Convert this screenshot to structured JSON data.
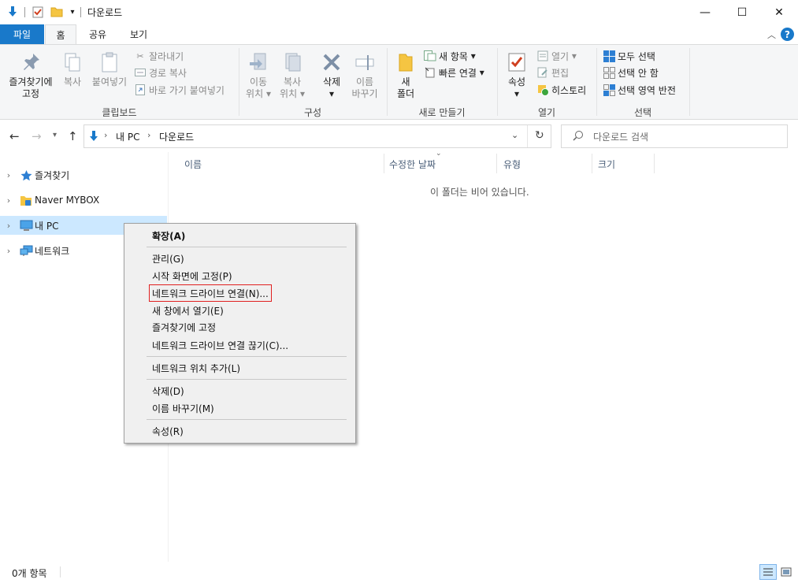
{
  "window": {
    "title": "다운로드",
    "minimize_glyph": "—",
    "maximize_glyph": "☐",
    "close_glyph": "✕"
  },
  "ribbon_tabs": [
    {
      "label": "파일"
    },
    {
      "label": "홈"
    },
    {
      "label": "공유"
    },
    {
      "label": "보기"
    }
  ],
  "ribbon": {
    "clipboard": {
      "label": "클립보드",
      "pin_line1": "즐겨찾기에",
      "pin_line2": "고정",
      "copy": "복사",
      "paste": "붙여넣기",
      "cut": "잘라내기",
      "copy_path": "경로 복사",
      "paste_shortcut": "바로 가기 붙여넣기"
    },
    "organize": {
      "label": "구성",
      "move_line1": "이동",
      "move_line2": "위치",
      "copy_line1": "복사",
      "copy_line2": "위치",
      "delete": "삭제",
      "rename_line1": "이름",
      "rename_line2": "바꾸기"
    },
    "new": {
      "label": "새로 만들기",
      "folder_line1": "새",
      "folder_line2": "폴더",
      "new_item": "새 항목",
      "easy_access": "빠른 연결"
    },
    "open": {
      "label": "열기",
      "properties": "속성",
      "open": "열기",
      "edit": "편집",
      "history": "히스토리"
    },
    "select": {
      "label": "선택",
      "select_all": "모두 선택",
      "select_none": "선택 안 함",
      "invert": "선택 영역 반전"
    }
  },
  "address": {
    "crumbs": [
      "내 PC",
      "다운로드"
    ],
    "search_placeholder": "다운로드 검색"
  },
  "nav": {
    "items": [
      {
        "label": "즐겨찾기"
      },
      {
        "label": "Naver MYBOX"
      },
      {
        "label": "내 PC"
      },
      {
        "label": "네트워크"
      }
    ]
  },
  "content": {
    "columns": [
      "이름",
      "수정한 날짜",
      "유형",
      "크기"
    ],
    "empty_message": "이 폴더는 비어 있습니다."
  },
  "status": {
    "item_count": "0개 항목"
  },
  "context_menu": {
    "items": [
      "확장(A)",
      "관리(G)",
      "시작 화면에 고정(P)",
      "네트워크 드라이브 연결(N)...",
      "새 창에서 열기(E)",
      "즐겨찾기에 고정",
      "네트워크 드라이브 연결 끊기(C)...",
      "네트워크 위치 추가(L)",
      "삭제(D)",
      "이름 바꾸기(M)",
      "속성(R)"
    ]
  },
  "colors": {
    "accent": "#1979ca",
    "selection": "#cce8ff",
    "highlight_box": "#e02020"
  }
}
